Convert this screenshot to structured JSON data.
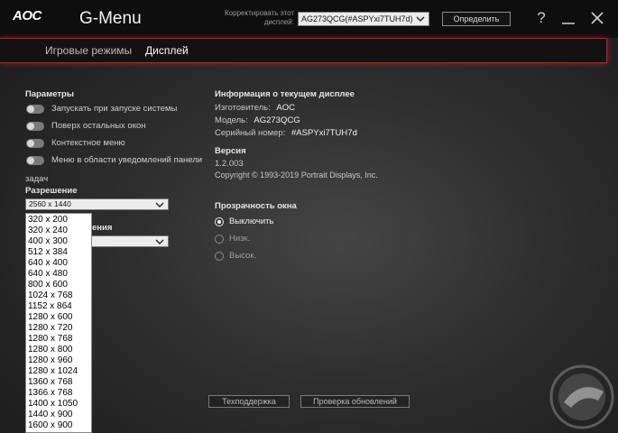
{
  "titlebar": {
    "logo": "AOC",
    "title": "G-Menu",
    "calibrate_label": "Корректировать этот дисплей:",
    "monitor_value": "AG273QCG(#ASPYxi7TUH7d)",
    "detect_button": "Определить",
    "help_glyph": "?"
  },
  "tabs": [
    {
      "label": "Игровые режимы"
    },
    {
      "label": "Дисплей"
    }
  ],
  "params": {
    "title": "Параметры",
    "toggles": [
      {
        "label": "Запускать при запуске системы"
      },
      {
        "label": "Поверх остальных окон"
      },
      {
        "label": "Контекстное меню"
      },
      {
        "label": "Меню в области уведомлений панели"
      }
    ],
    "wrap_text": "задач"
  },
  "resolution": {
    "title": "Разрешение",
    "value": "2560 x 1440",
    "hidden_label_fragment": "ения",
    "options": [
      "320 x 200",
      "320 x 240",
      "400 x 300",
      "512 x 384",
      "640 x 400",
      "640 x 480",
      "800 x 600",
      "1024 x 768",
      "1152 x 864",
      "1280 x 600",
      "1280 x 720",
      "1280 x 768",
      "1280 x 800",
      "1280 x 960",
      "1280 x 1024",
      "1360 x 768",
      "1366 x 768",
      "1400 x 1050",
      "1440 x 900",
      "1600 x 900"
    ]
  },
  "display_info": {
    "title": "Информация о текущем дисплее",
    "manufacturer_label": "Изготовитель:",
    "manufacturer": "AOC",
    "model_label": "Модель:",
    "model": "AG273QCG",
    "serial_label": "Серийный номер:",
    "serial": "#ASPYxi7TUH7d"
  },
  "version": {
    "title": "Версия",
    "number": "1.2.003",
    "copyright": "Copyright © 1993-2019 Portrait Displays, Inc."
  },
  "transparency": {
    "title": "Прозрачность окна",
    "options": [
      {
        "label": "Выключить",
        "selected": true
      },
      {
        "label": "Низк.",
        "selected": false
      },
      {
        "label": "Высок.",
        "selected": false
      }
    ]
  },
  "footer": {
    "support_button": "Техподдержка",
    "update_button": "Проверка обновлений"
  },
  "colors": {
    "accent_red": "#b4222a",
    "background": "#2e2e2e",
    "titlebar": "#0e0e0e"
  }
}
